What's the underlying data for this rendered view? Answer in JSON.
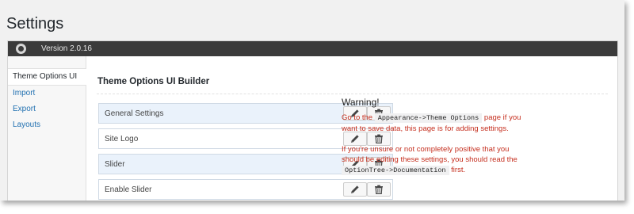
{
  "page": {
    "title": "Settings"
  },
  "topbar": {
    "version": "Version 2.0.16",
    "logo_icon": "theme-logo-icon"
  },
  "sidebar": {
    "items": [
      {
        "label": "Theme Options UI",
        "active": true
      },
      {
        "label": "Import",
        "active": false
      },
      {
        "label": "Export",
        "active": false
      },
      {
        "label": "Layouts",
        "active": false
      }
    ]
  },
  "builder": {
    "title": "Theme Options UI Builder",
    "settings": [
      {
        "label": "General Settings"
      },
      {
        "label": "Site Logo"
      },
      {
        "label": "Slider"
      },
      {
        "label": "Enable Slider"
      }
    ],
    "edit_icon": "pencil-icon",
    "delete_icon": "trash-icon"
  },
  "warning": {
    "title": "Warning!",
    "p1_before": "Go to the",
    "p1_code": "Appearance->Theme Options",
    "p1_after": "page if you want to save data, this page is for adding settings.",
    "p2_before": "If you're unsure or not completely positive that you should be editing these settings, you should read the",
    "p2_code": "OptionTree->Documentation",
    "p2_after": "first."
  },
  "colors": {
    "topbar": "#3b3b3b",
    "link": "#2271b1",
    "warning_text": "#c52e1e",
    "row_highlight": "#eaf2fb"
  }
}
